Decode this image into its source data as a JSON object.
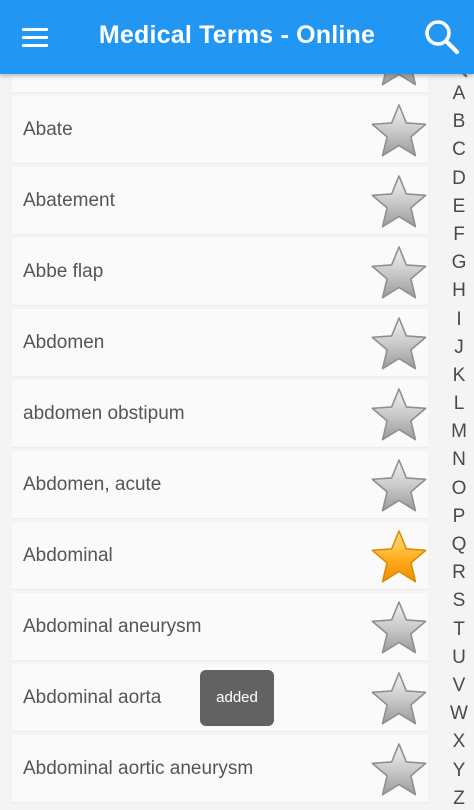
{
  "appbar": {
    "title": "Medical Terms - Online",
    "menu_icon": "hamburger-menu-icon",
    "search_icon": "search-icon",
    "background_color": "#2196f3"
  },
  "terms": [
    {
      "label": "",
      "favorite": false
    },
    {
      "label": "Abate",
      "favorite": false
    },
    {
      "label": "Abatement",
      "favorite": false
    },
    {
      "label": "Abbe flap",
      "favorite": false
    },
    {
      "label": "Abdomen",
      "favorite": false
    },
    {
      "label": "abdomen obstipum",
      "favorite": false
    },
    {
      "label": "Abdomen, acute",
      "favorite": false
    },
    {
      "label": "Abdominal",
      "favorite": true
    },
    {
      "label": "Abdominal aneurysm",
      "favorite": false
    },
    {
      "label": "Abdominal aorta",
      "favorite": false
    },
    {
      "label": "Abdominal aortic aneurysm",
      "favorite": false
    }
  ],
  "alphabet": [
    "A",
    "B",
    "C",
    "D",
    "E",
    "F",
    "G",
    "H",
    "I",
    "J",
    "K",
    "L",
    "M",
    "N",
    "O",
    "P",
    "Q",
    "R",
    "S",
    "T",
    "U",
    "V",
    "W",
    "X",
    "Y",
    "Z"
  ],
  "alphabet_search_icon": "search-icon",
  "toast": {
    "text": "added"
  },
  "colors": {
    "star_favorite": "#ffa000",
    "star_default": "#b5b5b5"
  }
}
